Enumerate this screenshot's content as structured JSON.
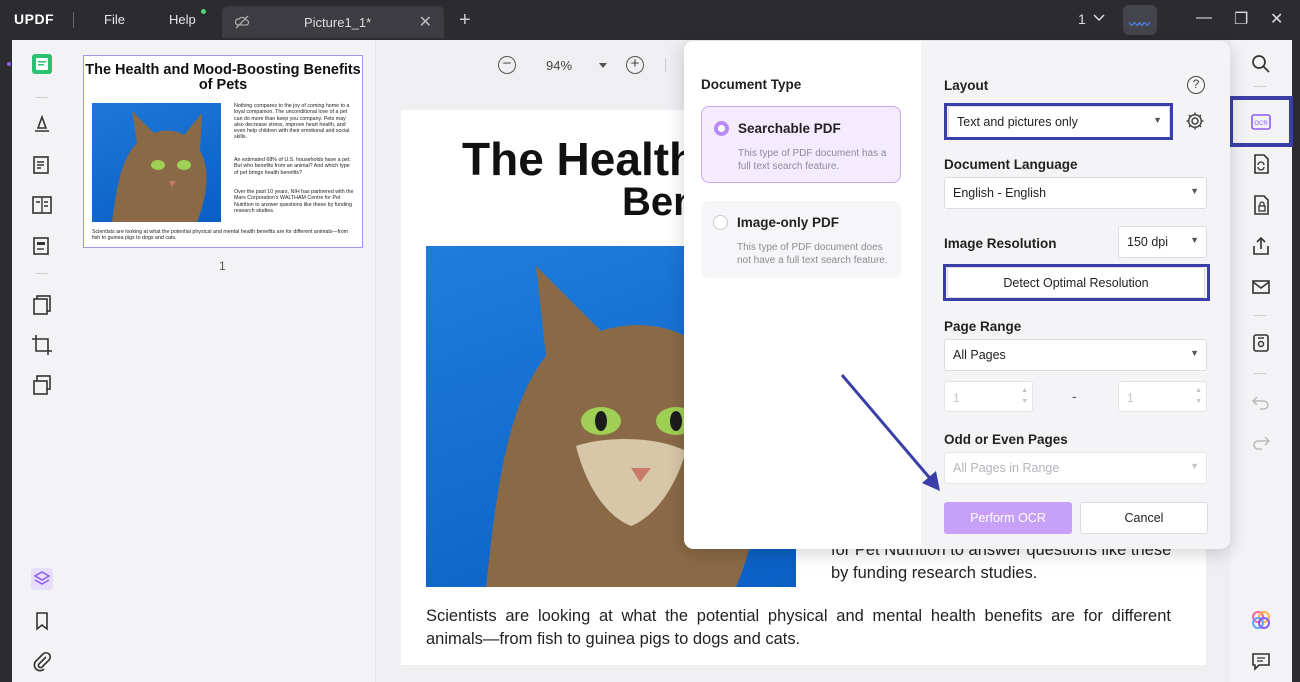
{
  "titlebar": {
    "logo_main": "UPDF",
    "menu_file": "File",
    "menu_help": "Help",
    "tab_title": "Picture1_1*",
    "page_indicator": "1",
    "new_tab": "+",
    "tab_close": "✕",
    "win_min": "—",
    "win_restore": "❐",
    "win_close": "✕"
  },
  "thumbnail": {
    "title": "The Health and Mood-Boosting Benefits of Pets",
    "para1": "Nothing compares to the joy of coming home to a loyal companion. The unconditional love of a pet can do more than keep you company. Pets may also decrease stress, improve heart health, and even help children with their emotional and social skills.",
    "para2": "An estimated 68% of U.S. households have a pet. But who benefits from an animal? And which type of pet brings health benefits?",
    "para3": "Over the past 10 years, NIH has partnered with the Mars Corporation's WALTHAM Centre for Pet Nutrition to answer questions like these by funding research studies.",
    "footer": "Scientists are looking at what the potential physical and mental health benefits are for different animals—from fish to guinea pigs to dogs and cats.",
    "page_number": "1"
  },
  "zoom": {
    "value": "94%"
  },
  "page": {
    "title_line1": "The Health",
    "title_line2": "Ben",
    "body_tail": "for Pet Nutrition to answer questions like these by funding research studies.",
    "footer": "Scientists are looking at what the potential physical and mental health benefits are for different animals—from fish to guinea pigs to dogs and cats."
  },
  "ocr_panel": {
    "doc_type_heading": "Document Type",
    "searchable_label": "Searchable PDF",
    "searchable_desc": "This type of PDF document has a full text search feature.",
    "image_only_label": "Image-only PDF",
    "image_only_desc": "This type of PDF document does not have a full text search feature.",
    "layout_heading": "Layout",
    "layout_value": "Text and pictures only",
    "language_heading": "Document Language",
    "language_value": "English - English",
    "resolution_heading": "Image Resolution",
    "resolution_value": "150 dpi",
    "detect_button": "Detect Optimal Resolution",
    "page_range_heading": "Page Range",
    "page_range_value": "All Pages",
    "range_from": "1",
    "range_to": "1",
    "range_dash": "-",
    "odd_even_heading": "Odd or Even Pages",
    "odd_even_value": "All Pages in Range",
    "perform_button": "Perform OCR",
    "cancel_button": "Cancel",
    "help_glyph": "?"
  },
  "colors": {
    "accent_purple": "#b88af3",
    "highlight_blue": "#3a3fa8",
    "perform_button_bg": "#c7a0f7"
  }
}
